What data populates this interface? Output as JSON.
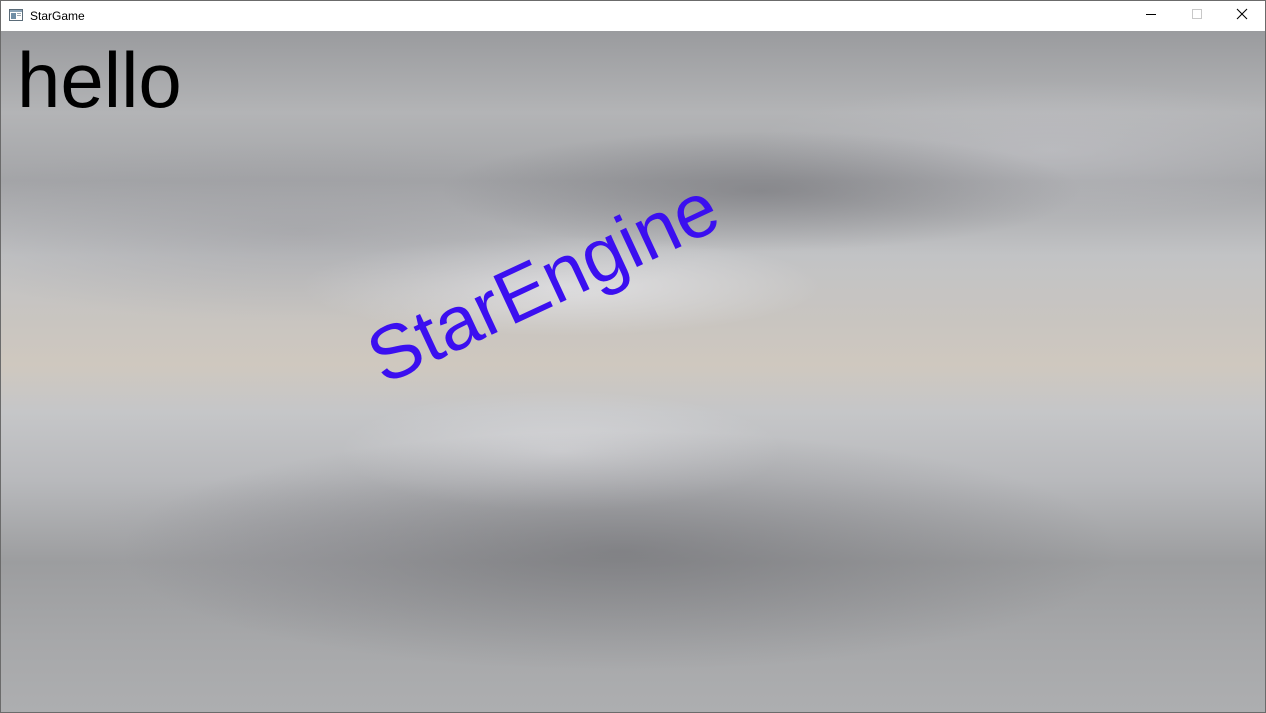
{
  "window": {
    "title": "StarGame",
    "app_icon": "app-window-icon",
    "controls": {
      "minimize_icon": "minimize-icon",
      "maximize_icon": "maximize-icon",
      "close_icon": "close-icon"
    }
  },
  "scene": {
    "hello_text": "hello",
    "hello_color": "#000000",
    "engine_text": "StarEngine",
    "engine_color": "#3b0ff0",
    "background": "cloudy-sky-skybox"
  }
}
